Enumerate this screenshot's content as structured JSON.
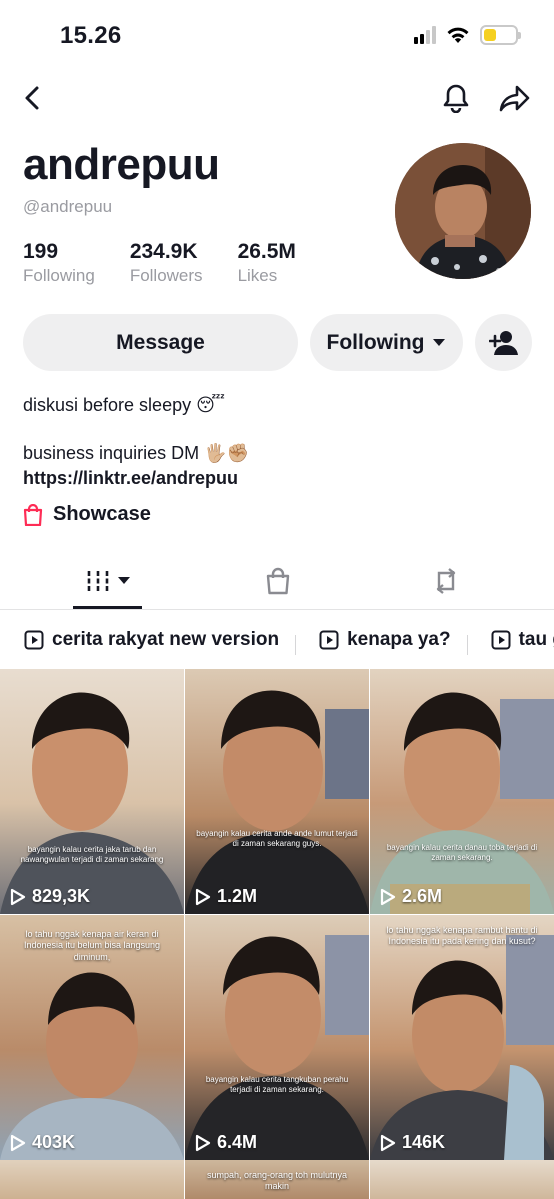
{
  "status": {
    "time": "15.26"
  },
  "profile": {
    "display_name": "andrepuu",
    "handle": "@andrepuu",
    "stats": [
      {
        "value": "199",
        "label": "Following"
      },
      {
        "value": "234.9K",
        "label": "Followers"
      },
      {
        "value": "26.5M",
        "label": "Likes"
      }
    ]
  },
  "actions": {
    "message_label": "Message",
    "following_label": "Following"
  },
  "bio": {
    "line1": "diskusi before sleepy 😴",
    "line2": "business inquiries DM 🖐🏼✊🏼",
    "link": "https://linktr.ee/andrepuu",
    "showcase_label": "Showcase"
  },
  "playlists": [
    {
      "label": "cerita rakyat new version"
    },
    {
      "label": "kenapa ya?"
    },
    {
      "label": "tau ga?"
    }
  ],
  "videos": [
    {
      "caption": "bayangin kalau cerita jaka tarub dan nawangwulan terjadi di zaman sekarang",
      "views": "829,3K"
    },
    {
      "caption": "bayangin kalau cerita ande ande lumut terjadi di zaman sekarang guys.",
      "views": "1.2M"
    },
    {
      "caption": "bayangin kalau cerita danau toba terjadi di zaman sekarang.",
      "views": "2.6M"
    },
    {
      "caption": "lo tahu nggak kenapa air keran di Indonesia itu belum bisa langsung diminum,",
      "views": "403K"
    },
    {
      "caption": "bayangin kalau cerita tangkuban perahu terjadi di zaman sekarang.",
      "views": "6.4M"
    },
    {
      "caption": "lo tahu nggak kenapa rambut hantu di Indonesia itu pada kering dan kusut?",
      "views": "146K"
    }
  ],
  "partial_videos": [
    {
      "caption": ""
    },
    {
      "caption": "sumpah, orang-orang toh mulutnya makin"
    },
    {
      "caption": ""
    }
  ],
  "colors": {
    "accent": "#fe2c55",
    "secondary_text": "#9a9ba1",
    "button_bg": "#efeff0"
  }
}
